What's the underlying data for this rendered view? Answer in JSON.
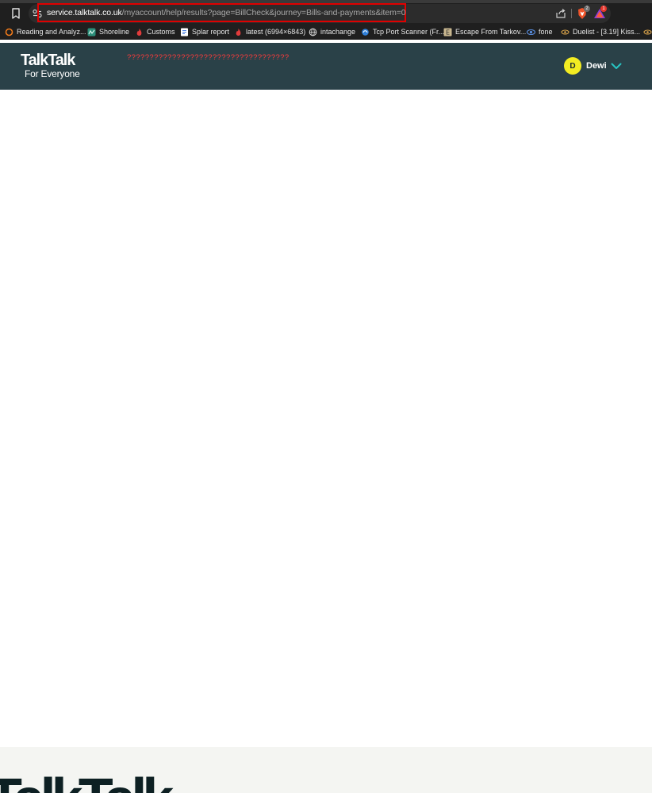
{
  "browser": {
    "url": {
      "host": "service.talktalk.co.uk",
      "path": "/myaccount/help/results?page=BillCheck&journey=Bills-and-payments&item=0"
    },
    "brave_shields_count": "2",
    "rewards_count": "1",
    "bookmarks": [
      {
        "label": "Reading and Analyz...",
        "icon": "orange-ring-icon"
      },
      {
        "label": "Shoreline",
        "icon": "shoreline-map-icon"
      },
      {
        "label": "Customs",
        "icon": "red-flame-icon"
      },
      {
        "label": "Splar report",
        "icon": "google-docs-icon"
      },
      {
        "label": "latest (6994×6843)",
        "icon": "red-flame-icon"
      },
      {
        "label": "intachange",
        "icon": "globe-icon"
      },
      {
        "label": "Tcp Port Scanner (Fr...",
        "icon": "blue-scanner-icon"
      },
      {
        "label": "Escape From Tarkov...",
        "icon": "tarkov-icon"
      },
      {
        "label": "fone",
        "icon": "blue-eye-icon"
      },
      {
        "label": "Duelist - [3.19] Kiss...",
        "icon": "eye-icon"
      }
    ],
    "colors": {
      "chrome": "#1f1f1f",
      "url_highlight": "#e00000"
    }
  },
  "header": {
    "logo_main": "TalkTalk",
    "logo_sub": "For Everyone",
    "garbled_text": "????????????????????????????????????",
    "account": {
      "initial": "D",
      "name": "Dewi"
    },
    "colors": {
      "background": "#2a4148",
      "avatar": "#f3ec22",
      "accent": "#27c4c2"
    }
  },
  "footer": {
    "logo_partial": "TalkTalk"
  }
}
